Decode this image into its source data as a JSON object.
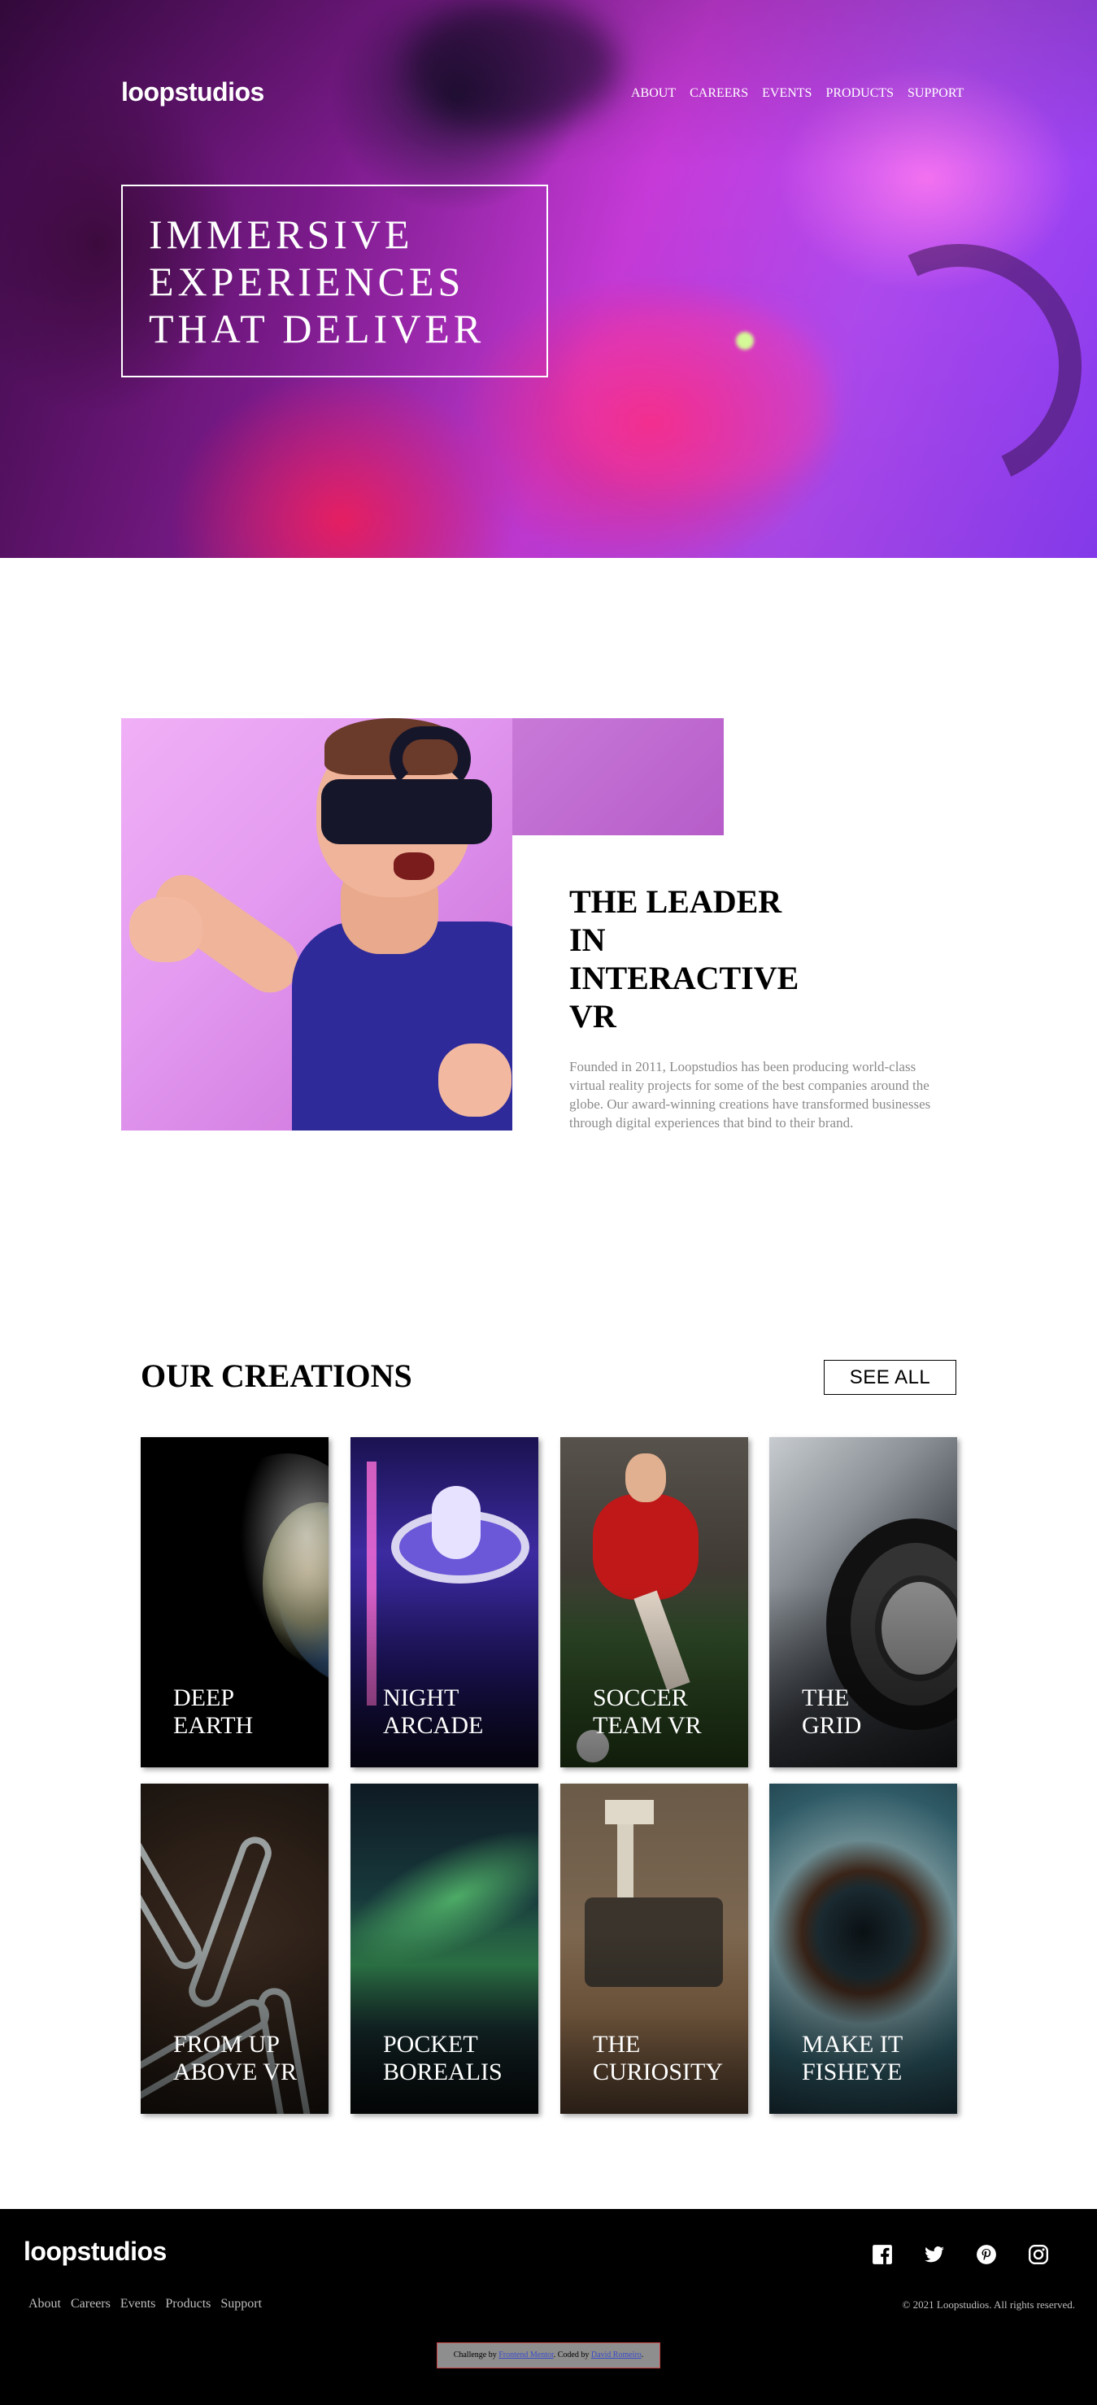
{
  "brand": {
    "name": "loopstudios"
  },
  "nav": {
    "items": [
      "ABOUT",
      "CAREERS",
      "EVENTS",
      "PRODUCTS",
      "SUPPORT"
    ]
  },
  "hero": {
    "lines": [
      "IMMERSIVE",
      "EXPERIENCES",
      "THAT DELIVER"
    ]
  },
  "leader": {
    "title_lines": [
      "THE LEADER",
      "IN",
      "INTERACTIVE",
      "VR"
    ],
    "text": "Founded in 2011, Loopstudios has been producing world-class virtual reality projects for some of the best companies around the globe. Our award-winning creations have transformed businesses through digital experiences that bind to their brand."
  },
  "creations": {
    "title": "OUR CREATIONS",
    "see_all": "SEE ALL",
    "cards": [
      {
        "l1": "DEEP",
        "l2": "EARTH"
      },
      {
        "l1": "NIGHT",
        "l2": "ARCADE"
      },
      {
        "l1": "SOCCER",
        "l2": "TEAM VR"
      },
      {
        "l1": "THE",
        "l2": "GRID"
      },
      {
        "l1": "FROM UP",
        "l2": "ABOVE VR"
      },
      {
        "l1": "POCKET",
        "l2": "BOREALIS"
      },
      {
        "l1": "THE",
        "l2": "CURIOSITY"
      },
      {
        "l1": "MAKE IT",
        "l2": "FISHEYE"
      }
    ]
  },
  "footer": {
    "nav": [
      "About",
      "Careers",
      "Events",
      "Products",
      "Support"
    ],
    "socials": [
      "facebook-icon",
      "twitter-icon",
      "pinterest-icon",
      "instagram-icon"
    ],
    "copyright": "© 2021 Loopstudios. All rights reserved."
  },
  "attribution": {
    "prefix": "Challenge by",
    "challenge_link": "Frontend Mentor",
    "middle": ". Coded by",
    "author_link": "David Romeiro",
    "suffix": "."
  }
}
